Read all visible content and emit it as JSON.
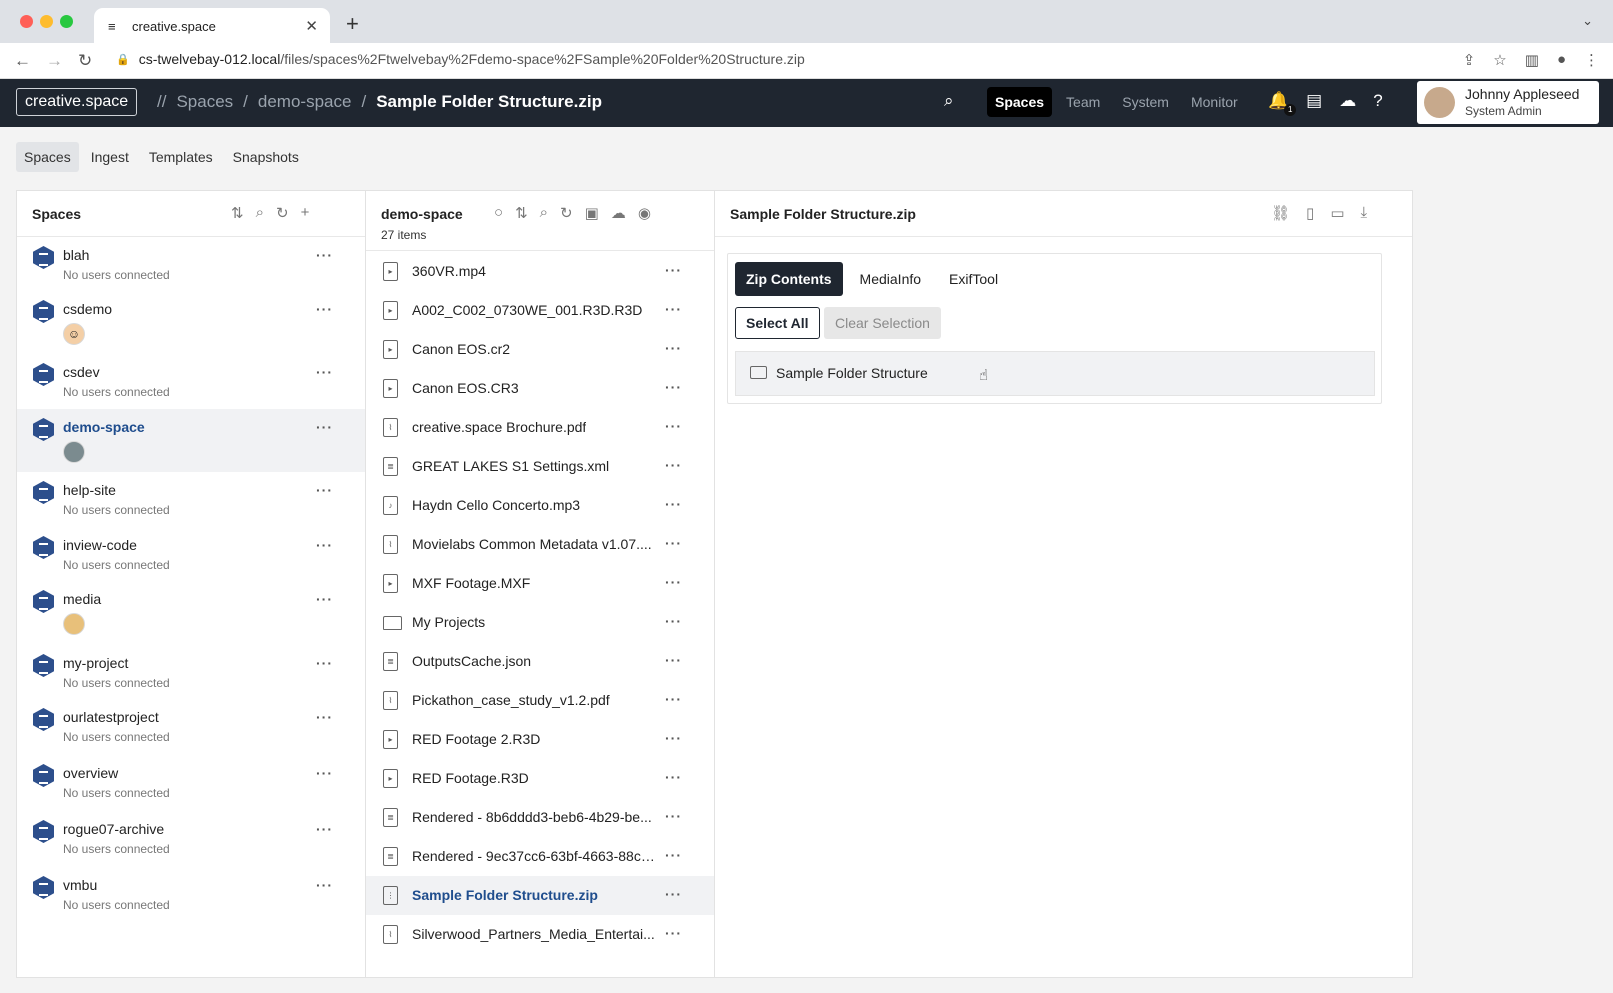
{
  "browser": {
    "tab_title": "creative.space",
    "url_host": "cs-twelvebay-012.local",
    "url_path": "/files/spaces%2Ftwelvebay%2Fdemo-space%2FSample%20Folder%20Structure.zip"
  },
  "header": {
    "logo": "creative.space",
    "crumb_sep": "//",
    "crumbs": [
      "Spaces",
      "/",
      "demo-space",
      "/",
      "Sample Folder Structure.zip"
    ],
    "nav": [
      "Spaces",
      "Team",
      "System",
      "Monitor"
    ],
    "notif_count": "1",
    "user_name": "Johnny Appleseed",
    "user_role": "System Admin"
  },
  "subnav": [
    "Spaces",
    "Ingest",
    "Templates",
    "Snapshots"
  ],
  "spaces_panel": {
    "title": "Spaces",
    "items": [
      {
        "name": "blah",
        "sub": "No users connected"
      },
      {
        "name": "csdemo",
        "sub": ""
      },
      {
        "name": "csdev",
        "sub": "No users connected"
      },
      {
        "name": "demo-space",
        "sub": ""
      },
      {
        "name": "help-site",
        "sub": "No users connected"
      },
      {
        "name": "inview-code",
        "sub": "No users connected"
      },
      {
        "name": "media",
        "sub": ""
      },
      {
        "name": "my-project",
        "sub": "No users connected"
      },
      {
        "name": "ourlatestproject",
        "sub": "No users connected"
      },
      {
        "name": "overview",
        "sub": "No users connected"
      },
      {
        "name": "rogue07-archive",
        "sub": "No users connected"
      },
      {
        "name": "vmbu",
        "sub": "No users connected"
      }
    ]
  },
  "files_panel": {
    "title": "demo-space",
    "count": "27 items",
    "files": [
      "360VR.mp4",
      "A002_C002_0730WE_001.R3D.R3D",
      "Canon EOS.cr2",
      "Canon EOS.CR3",
      "creative.space Brochure.pdf",
      "GREAT LAKES S1 Settings.xml",
      "Haydn Cello Concerto.mp3",
      "Movielabs Common Metadata v1.07....",
      "MXF Footage.MXF",
      "My Projects",
      "OutputsCache.json",
      "Pickathon_case_study_v1.2.pdf",
      "RED Footage 2.R3D",
      "RED Footage.R3D",
      "Rendered - 8b6dddd3-beb6-4b29-be...",
      "Rendered - 9ec37cc6-63bf-4663-88c4...",
      "Sample Folder Structure.zip",
      "Silverwood_Partners_Media_Entertai..."
    ]
  },
  "detail_panel": {
    "title": "Sample Folder Structure.zip",
    "tabs": [
      "Zip Contents",
      "MediaInfo",
      "ExifTool"
    ],
    "select_all": "Select All",
    "clear_selection": "Clear Selection",
    "zip_item": "Sample Folder Structure"
  }
}
